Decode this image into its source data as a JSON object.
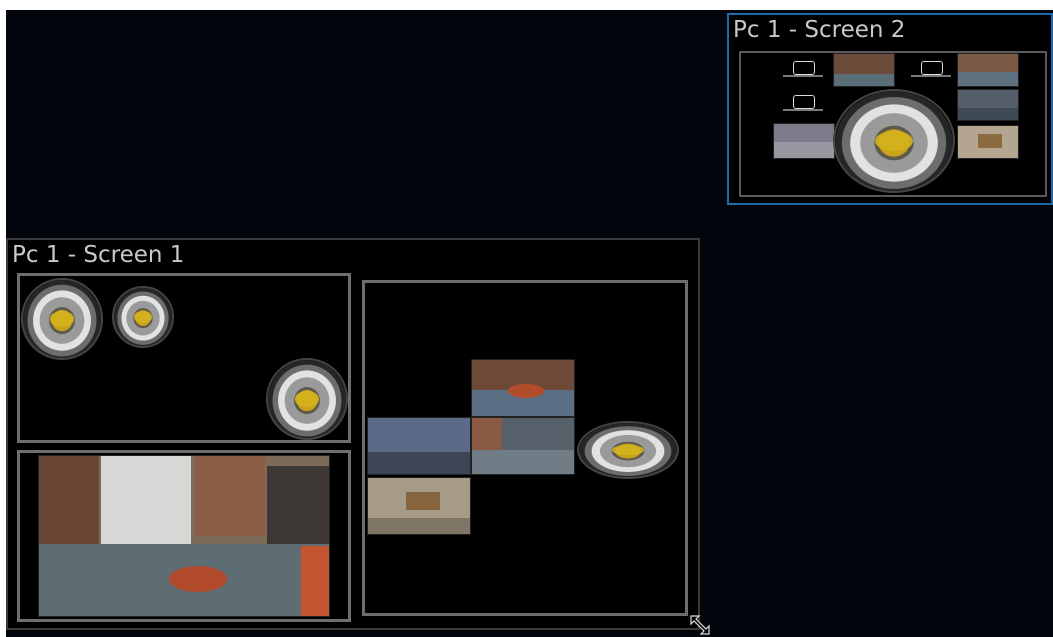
{
  "screens": [
    {
      "id": "screen-2",
      "title": "Pc 1 - Screen 2",
      "selected": true
    },
    {
      "id": "screen-1",
      "title": "Pc 1 - Screen 1",
      "selected": false
    }
  ],
  "icons": {
    "resize": "resize-handle-icon"
  },
  "colors": {
    "background": "#03050c",
    "selected_border": "#1f6aa8",
    "pane_border": "#6e6e6e",
    "title_text": "#c9c9c9"
  }
}
